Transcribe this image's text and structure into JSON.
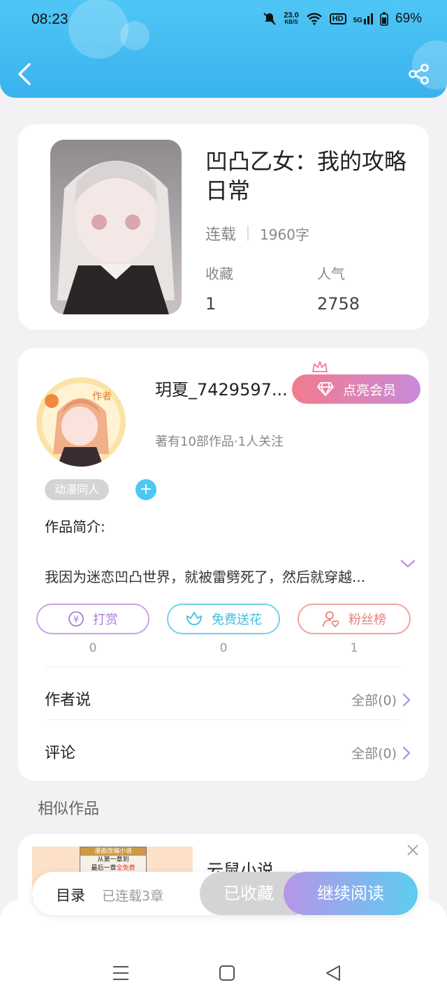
{
  "status_bar": {
    "time": "08:23",
    "net_speed": "23.0",
    "net_unit": "KB/S",
    "hd": "HD",
    "signal": "5G",
    "battery": "69%"
  },
  "book": {
    "title": "凹凸乙女：我的攻略日常",
    "state": "连载",
    "word_count": "1960字",
    "favorites_label": "收藏",
    "favorites_value": "1",
    "popularity_label": "人气",
    "popularity_value": "2758"
  },
  "author": {
    "name": "玥夏_7429597...",
    "vip_label": "点亮会员",
    "works": "著有10部作品·1人关注",
    "badge": "作者",
    "tag": "动漫同人"
  },
  "intro": {
    "label": "作品简介:",
    "text": "我因为迷恋凹凸世界，就被雷劈死了，然后就穿越..."
  },
  "actions": [
    {
      "label": "打赏",
      "count": "0"
    },
    {
      "label": "免费送花",
      "count": "0"
    },
    {
      "label": "粉丝榜",
      "count": "1"
    }
  ],
  "author_says": {
    "label": "作者说",
    "all": "全部(0)"
  },
  "comments": {
    "label": "评论",
    "all": "全部(0)"
  },
  "similar": {
    "title": "相似作品",
    "item_name": "云鼠小说",
    "thumb_line1": "漫画改编小说",
    "thumb_line2": "从第一章到",
    "thumb_line3": "最后一章",
    "thumb_free": "全免费"
  },
  "bottom_bar": {
    "toc": "目录",
    "chapters": "已连载3章",
    "collected": "已收藏",
    "continue": "继续阅读"
  },
  "colors": {
    "header": "#3ab2ee",
    "vip_start": "#f27b8e",
    "vip_end": "#c88bd9",
    "continue_start": "#b795e9",
    "continue_end": "#5ccdf0"
  }
}
